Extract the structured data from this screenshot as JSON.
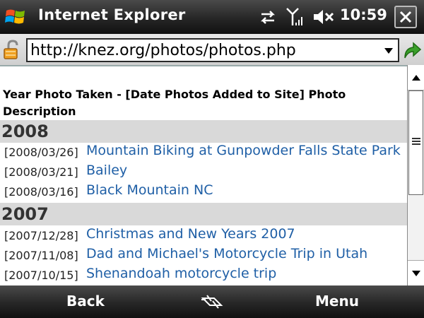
{
  "titlebar": {
    "app_title": "Internet Explorer",
    "time": "10:59",
    "icons": [
      "windows-start-icon",
      "data-connection-icon",
      "signal-strength-icon",
      "speaker-muted-icon",
      "close-icon"
    ]
  },
  "address": {
    "url": "http://knez.org/photos/photos.php",
    "icons": [
      "security-lock-icon",
      "dropdown-arrow-icon",
      "go-arrow-icon"
    ]
  },
  "page": {
    "header": "Year Photo Taken - [Date Photos Added to Site]     Photo Description",
    "groups": [
      {
        "year": "2008",
        "entries": [
          {
            "date": "[2008/03/26]",
            "title": "Mountain Biking at Gunpowder Falls State Park"
          },
          {
            "date": "[2008/03/21]",
            "title": "Bailey"
          },
          {
            "date": "[2008/03/16]",
            "title": "Black Mountain NC"
          }
        ]
      },
      {
        "year": "2007",
        "entries": [
          {
            "date": "[2007/12/28]",
            "title": "Christmas and New Years 2007"
          },
          {
            "date": "[2007/11/08]",
            "title": "Dad and Michael's Motorcycle Trip in Utah"
          },
          {
            "date": "[2007/10/15]",
            "title": "Shenandoah motorcycle trip"
          }
        ]
      }
    ]
  },
  "softkeys": {
    "left": "Back",
    "right": "Menu"
  },
  "colors": {
    "link": "#1f5fa6",
    "year_band": "#d9d9d9",
    "bar_dark": "#262626"
  }
}
